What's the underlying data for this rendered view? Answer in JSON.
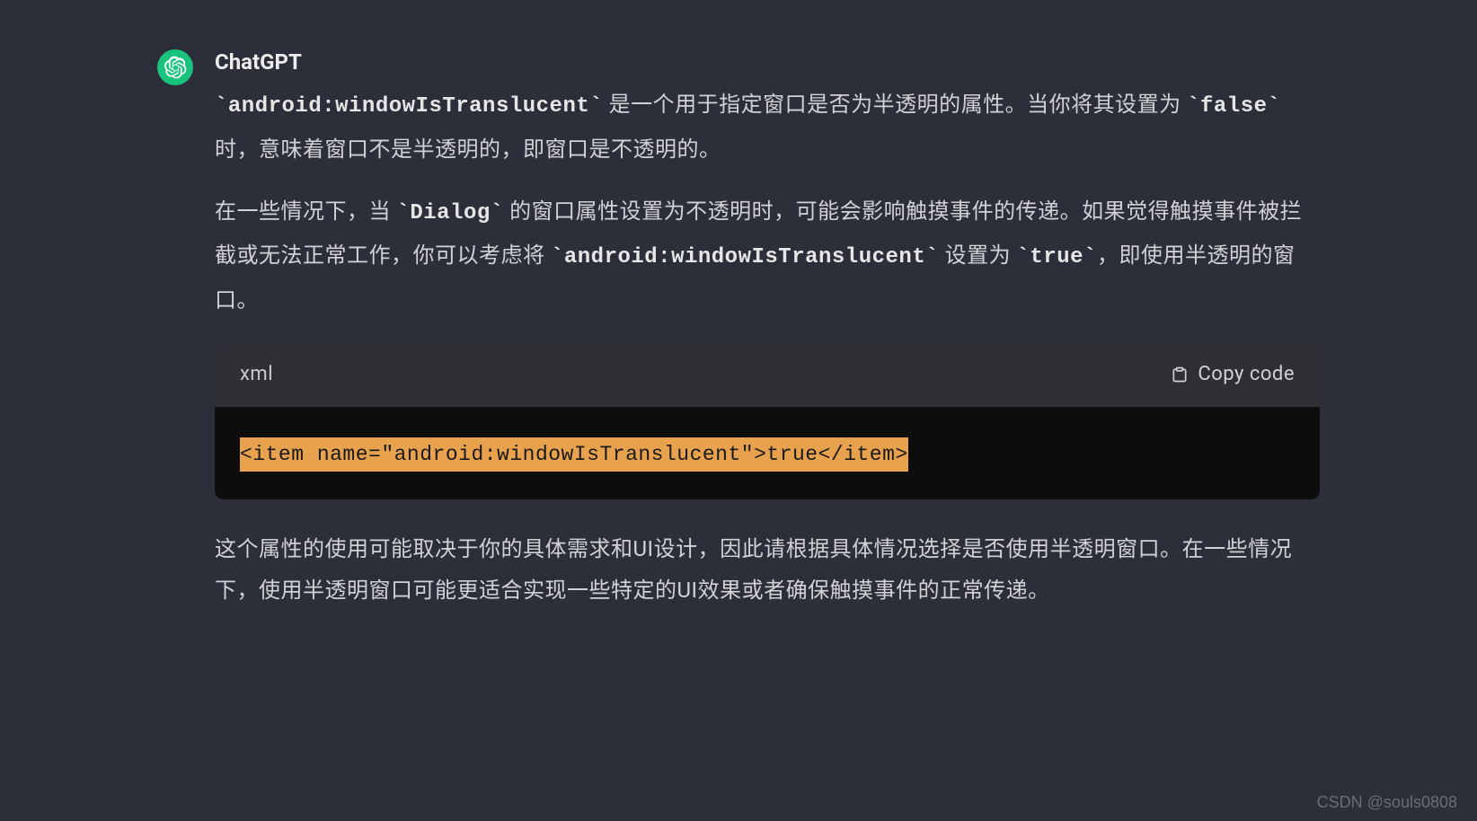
{
  "author": "ChatGPT",
  "paragraphs": {
    "p1_seg1_code": "`android:windowIsTranslucent`",
    "p1_seg2": " 是一个用于指定窗口是否为半透明的属性。当你将其设置为 ",
    "p1_seg3_code": "`false`",
    "p1_seg4": " 时，意味着窗口不是半透明的，即窗口是不透明的。",
    "p2_seg1": "在一些情况下，当 ",
    "p2_seg2_code": "`Dialog`",
    "p2_seg3": " 的窗口属性设置为不透明时，可能会影响触摸事件的传递。如果觉得触摸事件被拦截或无法正常工作，你可以考虑将 ",
    "p2_seg4_code": "`android:windowIsTranslucent`",
    "p2_seg5": " 设置为 ",
    "p2_seg6_code": "`true`",
    "p2_seg7": "，即使用半透明的窗口。",
    "p3": "这个属性的使用可能取决于你的具体需求和UI设计，因此请根据具体情况选择是否使用半透明窗口。在一些情况下，使用半透明窗口可能更适合实现一些特定的UI效果或者确保触摸事件的正常传递。"
  },
  "code_block": {
    "language": "xml",
    "copy_label": "Copy code",
    "content": "<item name=\"android:windowIsTranslucent\">true</item>"
  },
  "watermark": "CSDN @souls0808"
}
